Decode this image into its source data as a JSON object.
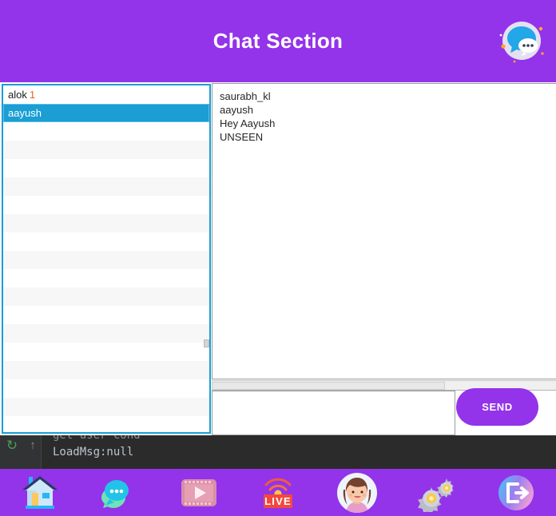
{
  "header": {
    "title": "Chat Section",
    "icon": "chat-bubble-icon",
    "background_color": "#9333ea"
  },
  "user_list": {
    "selected_index": 1,
    "rows": [
      {
        "name": "alok",
        "badge": "1",
        "selected": false
      },
      {
        "name": "aayush",
        "badge": "",
        "selected": true
      },
      {
        "name": "",
        "badge": "",
        "selected": false
      },
      {
        "name": "",
        "badge": "",
        "selected": false
      },
      {
        "name": "",
        "badge": "",
        "selected": false
      },
      {
        "name": "",
        "badge": "",
        "selected": false
      },
      {
        "name": "",
        "badge": "",
        "selected": false
      },
      {
        "name": "",
        "badge": "",
        "selected": false
      },
      {
        "name": "",
        "badge": "",
        "selected": false
      },
      {
        "name": "",
        "badge": "",
        "selected": false
      },
      {
        "name": "",
        "badge": "",
        "selected": false
      },
      {
        "name": "",
        "badge": "",
        "selected": false
      },
      {
        "name": "",
        "badge": "",
        "selected": false
      },
      {
        "name": "",
        "badge": "",
        "selected": false
      },
      {
        "name": "",
        "badge": "",
        "selected": false
      },
      {
        "name": "",
        "badge": "",
        "selected": false
      },
      {
        "name": "",
        "badge": "",
        "selected": false
      },
      {
        "name": "",
        "badge": "",
        "selected": false
      },
      {
        "name": "",
        "badge": "",
        "selected": false
      }
    ],
    "selection_color": "#1a9ed4",
    "badge_color": "#e8641c",
    "border_color": "#1a9ed4"
  },
  "chat": {
    "lines": [
      "saurabh_kl",
      "aayush",
      "Hey Aayush",
      "UNSEEN"
    ]
  },
  "composer": {
    "message_value": "",
    "message_placeholder": "",
    "send_label": "SEND",
    "send_color": "#9333ea"
  },
  "console": {
    "line1": "get user cond",
    "line2": "LoadMsg:null",
    "rerun_icon": "rerun-icon",
    "scroll_up_icon": "scroll-up-icon"
  },
  "bottom_nav": {
    "items": [
      {
        "icon": "home-icon",
        "label": "Home"
      },
      {
        "icon": "chat-icon",
        "label": "Chat"
      },
      {
        "icon": "video-icon",
        "label": "Video"
      },
      {
        "icon": "live-icon",
        "label": "LIVE"
      },
      {
        "icon": "profile-avatar-icon",
        "label": "Profile"
      },
      {
        "icon": "settings-gears-icon",
        "label": "Settings"
      },
      {
        "icon": "logout-icon",
        "label": "Logout"
      }
    ],
    "background_color": "#9333ea"
  }
}
